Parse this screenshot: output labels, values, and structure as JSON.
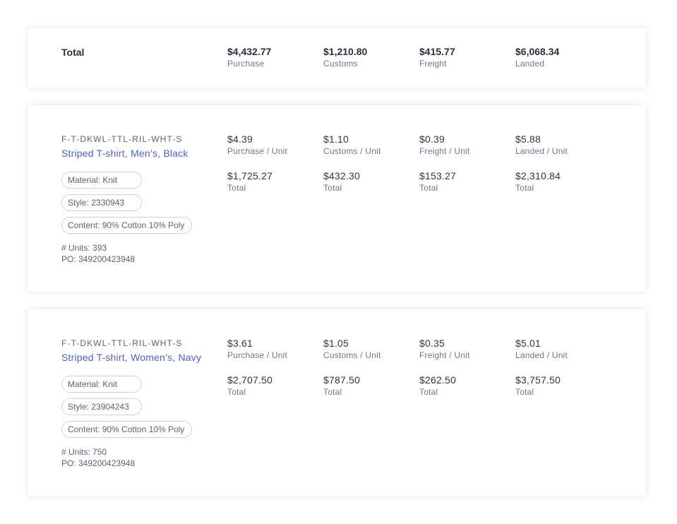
{
  "summary": {
    "label": "Total",
    "columns": [
      {
        "value": "$4,432.77",
        "label": "Purchase"
      },
      {
        "value": "$1,210.80",
        "label": "Customs"
      },
      {
        "value": "$415.77",
        "label": "Freight"
      },
      {
        "value": "$6,068.34",
        "label": "Landed"
      }
    ]
  },
  "items": [
    {
      "sku": "F-T-DKWL-TTL-RIL-WHT-S",
      "name": "Striped T-shirt, Men’s, Black",
      "tags": [
        "Material: Knit",
        "Style: 2330943",
        "Content: 90% Cotton 10% Poly"
      ],
      "units": "# Units: 393",
      "po": "PO: 349200423948",
      "unit_costs": [
        {
          "value": "$4.39",
          "label": "Purchase / Unit"
        },
        {
          "value": "$1.10",
          "label": "Customs / Unit"
        },
        {
          "value": "$0.39",
          "label": "Freight / Unit"
        },
        {
          "value": "$5.88",
          "label": "Landed / Unit"
        }
      ],
      "totals": [
        {
          "value": "$1,725.27",
          "label": "Total"
        },
        {
          "value": "$432.30",
          "label": "Total"
        },
        {
          "value": "$153.27",
          "label": "Total"
        },
        {
          "value": "$2,310.84",
          "label": "Total"
        }
      ]
    },
    {
      "sku": "F-T-DKWL-TTL-RIL-WHT-S",
      "name": "Striped T-shirt, Women’s, Navy",
      "tags": [
        "Material: Knit",
        "Style: 23904243",
        "Content: 90% Cotton 10% Poly"
      ],
      "units": "# Units: 750",
      "po": "PO: 349200423948",
      "unit_costs": [
        {
          "value": "$3.61",
          "label": "Purchase / Unit"
        },
        {
          "value": "$1.05",
          "label": "Customs / Unit"
        },
        {
          "value": "$0.35",
          "label": "Freight / Unit"
        },
        {
          "value": "$5.01",
          "label": "Landed / Unit"
        }
      ],
      "totals": [
        {
          "value": "$2,707.50",
          "label": "Total"
        },
        {
          "value": "$787.50",
          "label": "Total"
        },
        {
          "value": "$262.50",
          "label": "Total"
        },
        {
          "value": "$3,757.50",
          "label": "Total"
        }
      ]
    }
  ]
}
